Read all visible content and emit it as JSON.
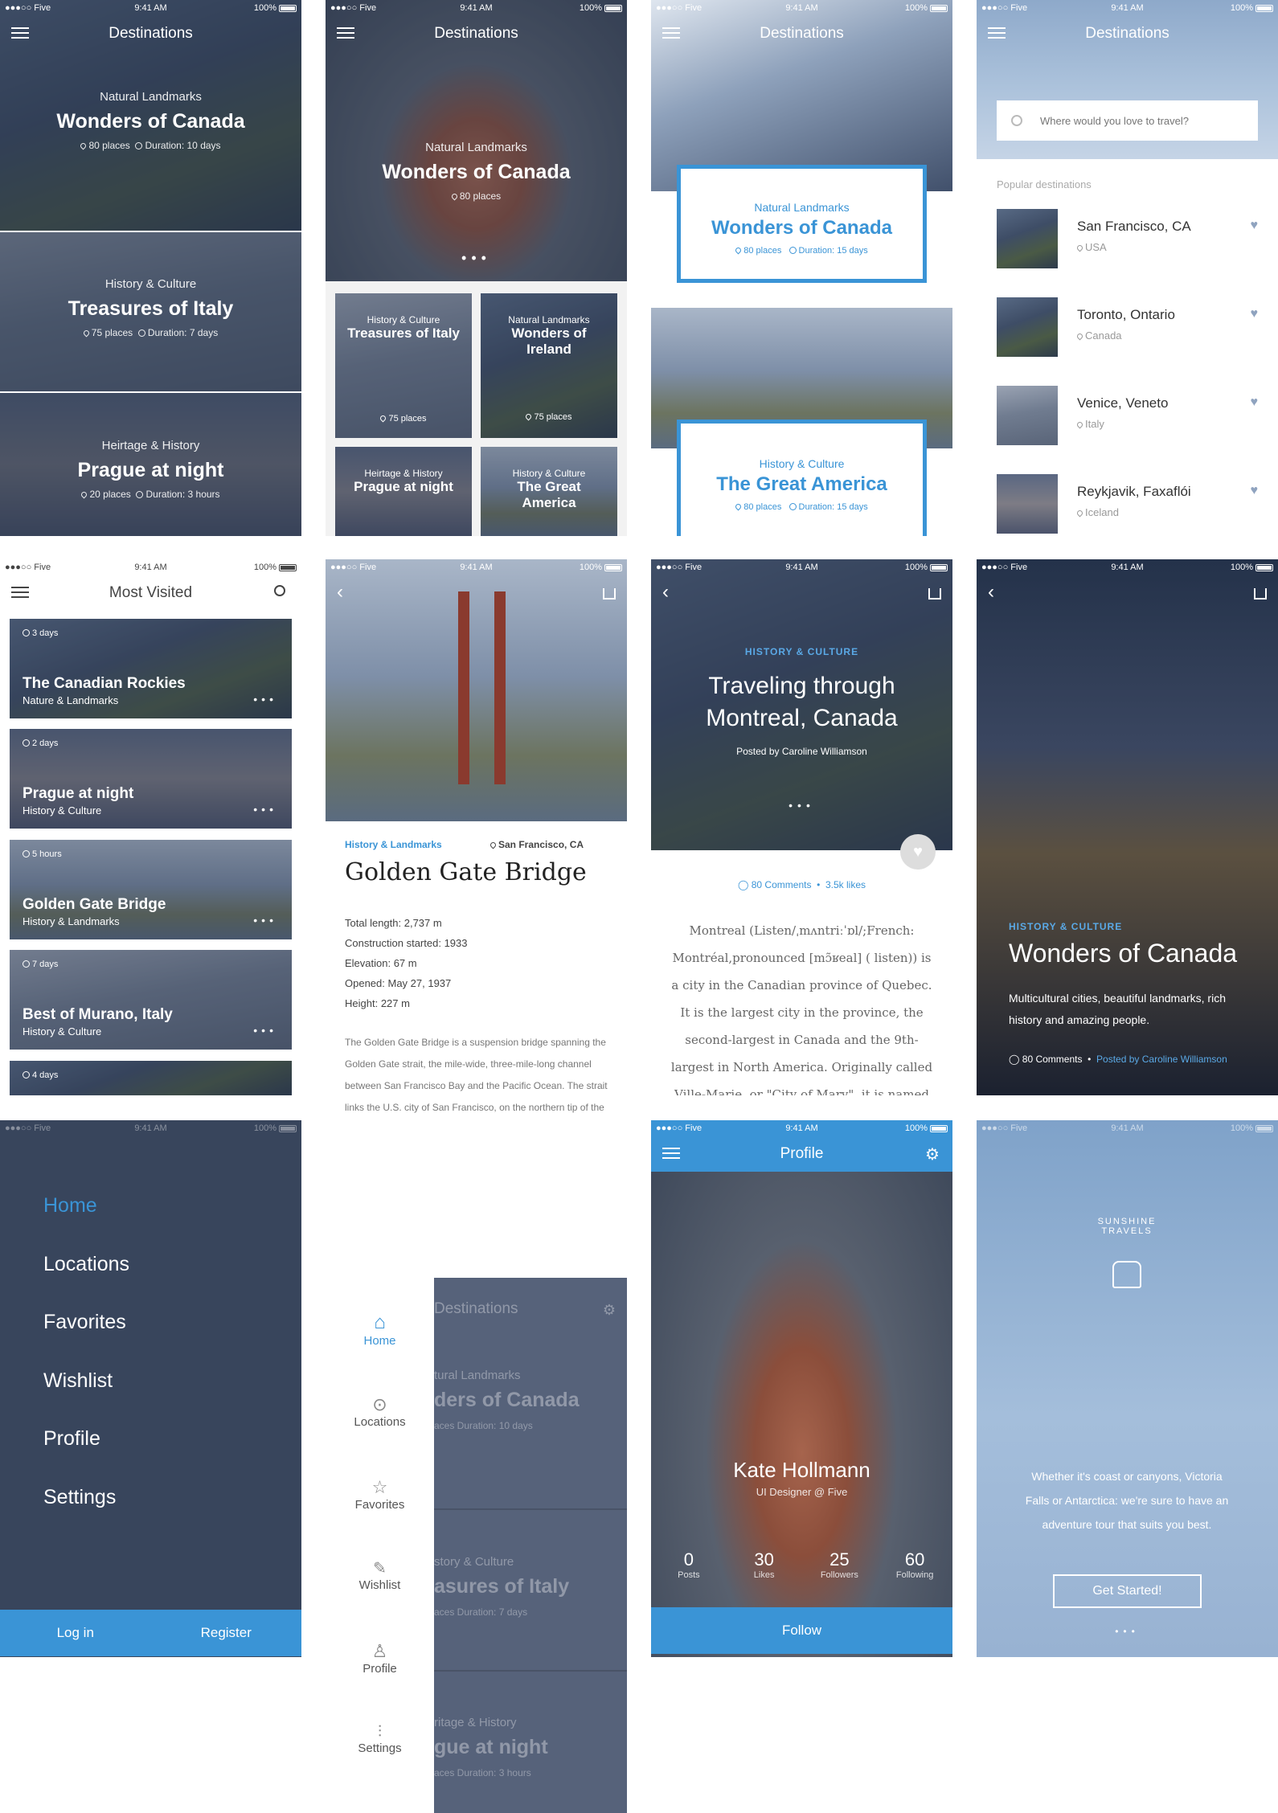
{
  "status": {
    "carrier": "Five",
    "time": "9:41 AM",
    "battery": "100%"
  },
  "s1": {
    "title": "Destinations",
    "items": [
      {
        "category": "Natural Landmarks",
        "title": "Wonders of Canada",
        "places": "80 places",
        "duration": "Duration: 10 days"
      },
      {
        "category": "History & Culture",
        "title": "Treasures of Italy",
        "places": "75 places",
        "duration": "Duration: 7 days"
      },
      {
        "category": "Heirtage & History",
        "title": "Prague at night",
        "places": "20 places",
        "duration": "Duration: 3 hours"
      }
    ]
  },
  "s2": {
    "title": "Destinations",
    "hero": {
      "category": "Natural Landmarks",
      "title": "Wonders of Canada",
      "places": "80 places"
    },
    "grid": [
      {
        "category": "History & Culture",
        "title": "Treasures of Italy",
        "places": "75 places"
      },
      {
        "category": "Natural Landmarks",
        "title": "Wonders of Ireland",
        "places": "75 places"
      },
      {
        "category": "Heirtage & History",
        "title": "Prague at night"
      },
      {
        "category": "History & Culture",
        "title": "The Great America"
      }
    ]
  },
  "s3": {
    "title": "Destinations",
    "cards": [
      {
        "category": "Natural Landmarks",
        "title": "Wonders of Canada",
        "places": "80 places",
        "duration": "Duration: 15 days"
      },
      {
        "category": "History & Culture",
        "title": "The Great America",
        "places": "80 places",
        "duration": "Duration: 15 days"
      }
    ]
  },
  "s4": {
    "title": "Destinations",
    "search_placeholder": "Where would you love to travel?",
    "section": "Popular destinations",
    "items": [
      {
        "name": "San Francisco, CA",
        "country": "USA"
      },
      {
        "name": "Toronto, Ontario",
        "country": "Canada"
      },
      {
        "name": "Venice, Veneto",
        "country": "Italy"
      },
      {
        "name": "Reykjavik, Faxaflói",
        "country": "Iceland"
      }
    ]
  },
  "s5": {
    "title": "Most Visited",
    "items": [
      {
        "duration": "3 days",
        "title": "The Canadian Rockies",
        "sub": "Nature & Landmarks"
      },
      {
        "duration": "2 days",
        "title": "Prague at night",
        "sub": "History & Culture"
      },
      {
        "duration": "5 hours",
        "title": "Golden Gate Bridge",
        "sub": "History & Landmarks"
      },
      {
        "duration": "7 days",
        "title": "Best of Murano, Italy",
        "sub": "History & Culture"
      },
      {
        "duration": "4 days"
      }
    ]
  },
  "s6": {
    "category": "History & Landmarks",
    "location": "San Francisco, CA",
    "title": "Golden Gate Bridge",
    "facts": [
      {
        "label": "Total length:",
        "value": " 2,737 m"
      },
      {
        "label": "Construction started:",
        "value": " 1933"
      },
      {
        "label": "Elevation:",
        "value": " 67 m"
      },
      {
        "label": "Opened:",
        "value": " May 27, 1937"
      },
      {
        "label": "Height:",
        "value": " 227 m"
      }
    ],
    "body": "The Golden Gate Bridge is a suspension bridge spanning the Golden Gate strait, the mile-wide, three-mile-long channel between San Francisco Bay and the Pacific Ocean. The strait links the U.S. city of San Francisco, on the northern tip of the San Francisco Peninsula, to Marin County, bridging both U.S. Route 101 and California State Route 1 across the strait. The bridge is one of the most internationally recognized symbols of San Francisco, California, and the United States.  It has been"
  },
  "s7": {
    "category": "HISTORY & CULTURE",
    "title": "Traveling through Montreal, Canada",
    "posted": "Posted by Caroline Williamson",
    "comments": "80 Comments",
    "likes": "3.5k likes",
    "body": "Montreal (Listen/ˌmʌntriːˈɒl/;French: Montréal,pronounced [mɔ̃ʁeal] ( listen)) is a city in the Canadian province of Quebec. It is the largest city in the province, the second-largest in Canada and the 9th-largest in North America. Originally called Ville-Marie, or \"City of Mary\", it is named"
  },
  "s8": {
    "category": "HISTORY & CULTURE",
    "title": "Wonders of Canada",
    "desc": "Multicultural cities, beautiful landmarks, rich history and amazing people.",
    "comments": "80 Comments",
    "posted": "Posted by Caroline Williamson"
  },
  "s9": {
    "menu": [
      "Home",
      "Locations",
      "Favorites",
      "Wishlist",
      "Profile",
      "Settings"
    ],
    "login": "Log in",
    "register": "Register"
  },
  "s10": {
    "menu": [
      "Home",
      "Locations",
      "Favorites",
      "Wishlist",
      "Profile",
      "Settings"
    ],
    "bg_title": "Destinations",
    "bg_cat1": "tural Landmarks",
    "bg_title1": "ders of Canada",
    "bg_meta1": "aces  Duration: 10 days",
    "bg_cat2": "story & Culture",
    "bg_title2": "asures of Italy",
    "bg_meta2": "aces  Duration: 7 days",
    "bg_cat3": "ritage & History",
    "bg_title3": "gue at night",
    "bg_meta3": "aces  Duration: 3 hours"
  },
  "s11": {
    "title": "Profile",
    "name": "Kate Hollmann",
    "role": "UI Designer @ Five",
    "stats": [
      {
        "value": "0",
        "label": "Posts"
      },
      {
        "value": "30",
        "label": "Likes"
      },
      {
        "value": "25",
        "label": "Followers"
      },
      {
        "value": "60",
        "label": "Following"
      }
    ],
    "follow": "Follow"
  },
  "s12": {
    "logo_text": "SUNSHINE TRAVELS",
    "tagline": "Whether it's coast or canyons, Victoria Falls or Antarctica: we're sure to have an adventure tour that suits you best.",
    "cta": "Get Started!"
  },
  "colors": {
    "accent": "#3a94d6",
    "dark": "#38455c",
    "overlay": "#2c3a52"
  }
}
